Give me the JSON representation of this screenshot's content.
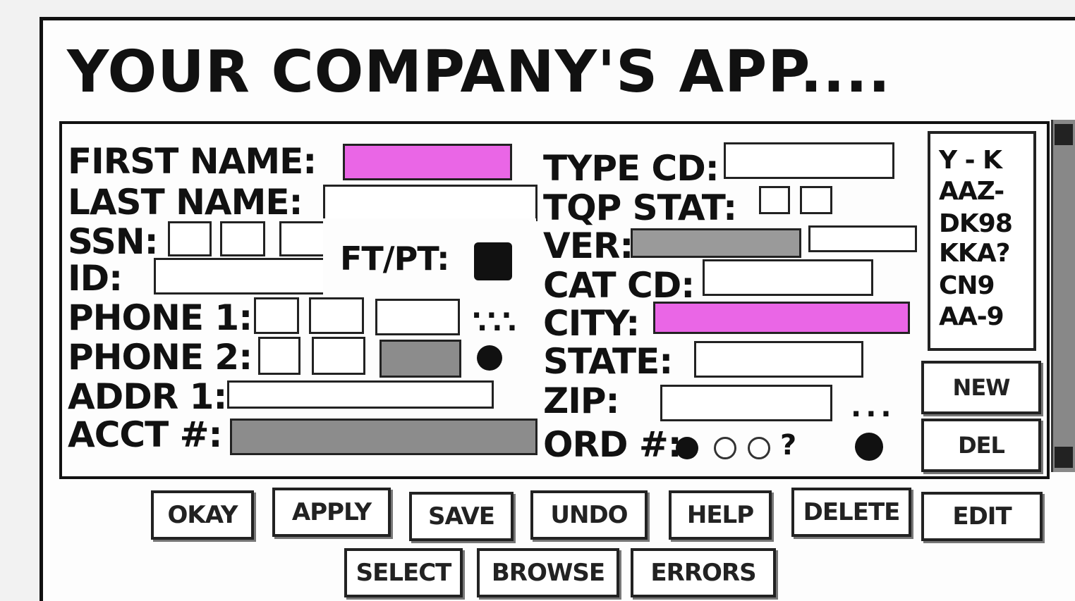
{
  "app": {
    "title": "YOUR COMPANY'S APP...."
  },
  "form": {
    "first_name_label": "FIRST NAME:",
    "last_name_label": "LAST NAME:",
    "ssn_label": "SSN:",
    "id_label": "ID:",
    "phone1_label": "PHONE 1:",
    "phone2_label": "PHONE 2:",
    "addr1_label": "ADDR 1:",
    "acct_label": "ACCT #:",
    "ftpt_label": "FT/PT:",
    "type_cd_label": "TYPE CD:",
    "tqp_stat_label": "TQP STAT:",
    "ver_label": "VER:",
    "cat_cd_label": "CAT CD:",
    "city_label": "CITY:",
    "state_label": "STATE:",
    "zip_label": "ZIP:",
    "ord_label": "ORD #:",
    "ord_question": "?",
    "ellipsis": "..."
  },
  "list": {
    "items": [
      "Y - K",
      "AAZ-",
      "DK98",
      "KKA?",
      "CN9",
      "AA-9"
    ]
  },
  "side_buttons": {
    "new": "NEW",
    "del": "DEL"
  },
  "buttons": {
    "okay": "OKAY",
    "apply": "APPLY",
    "save": "SAVE",
    "undo": "UNDO",
    "help": "HELP",
    "delete": "DELETE",
    "edit": "EDIT",
    "select": "SELECT",
    "browse": "BROWSE",
    "errors": "ERRORS"
  },
  "colors": {
    "highlight": "#ea66e6",
    "disabled": "#8c8c8c"
  }
}
